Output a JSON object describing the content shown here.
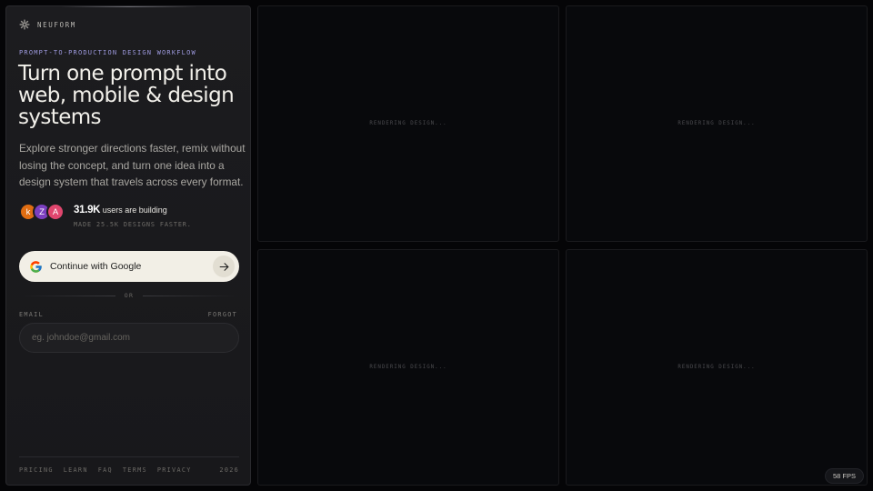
{
  "brand": {
    "name": "NEUFORM",
    "icon": "gear-logo-icon"
  },
  "hero": {
    "eyebrow": "PROMPT-TO-PRODUCTION DESIGN WORKFLOW",
    "headline": "Turn one prompt into web, mobile & design systems",
    "description": "Explore stronger directions faster, remix without losing the concept, and turn one idea into a design system that travels across every format."
  },
  "social_proof": {
    "avatars": [
      {
        "initial": "k",
        "color": "#e06d12"
      },
      {
        "initial": "Z",
        "color": "#7b3fbf"
      },
      {
        "initial": "A",
        "color": "#e0466e"
      }
    ],
    "count": "31.9K",
    "count_suffix": "users are building",
    "subline": "MADE 25.5K DESIGNS FASTER."
  },
  "auth": {
    "google_label": "Continue with Google",
    "or_label": "OR",
    "email_label": "EMAIL",
    "forgot_label": "FORGOT",
    "email_placeholder": "eg. johndoe@gmail.com",
    "email_value": ""
  },
  "footer": {
    "links": [
      "PRICING",
      "LEARN",
      "FAQ",
      "TERMS",
      "PRIVACY"
    ],
    "year": "2026"
  },
  "panels": [
    {
      "status": "RENDERING DESIGN..."
    },
    {
      "status": "RENDERING DESIGN..."
    },
    {
      "status": "RENDERING DESIGN..."
    },
    {
      "status": "RENDERING DESIGN..."
    }
  ],
  "fps": "58 FPS",
  "colors": {
    "accent": "#9e9ade",
    "button_bg": "#f2efe6",
    "panel_bg": "#08090c",
    "sidebar_bg": "#1c1c1f"
  }
}
